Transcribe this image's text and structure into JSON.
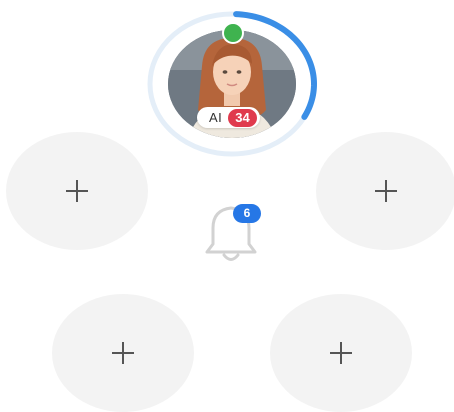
{
  "profile": {
    "ai_label": "AI",
    "ai_score": "34",
    "online": true,
    "progress_fraction": 0.32,
    "colors": {
      "progress": "#3a8ee6",
      "track": "#e4eef8",
      "online_dot": "#3fb34f",
      "score_badge": "#e03a4d"
    }
  },
  "slots": [
    {
      "icon": "plus-icon"
    },
    {
      "icon": "plus-icon"
    },
    {
      "icon": "plus-icon"
    },
    {
      "icon": "plus-icon"
    }
  ],
  "notifications": {
    "icon": "bell-icon",
    "count": "6",
    "badge_color": "#2677e6"
  }
}
